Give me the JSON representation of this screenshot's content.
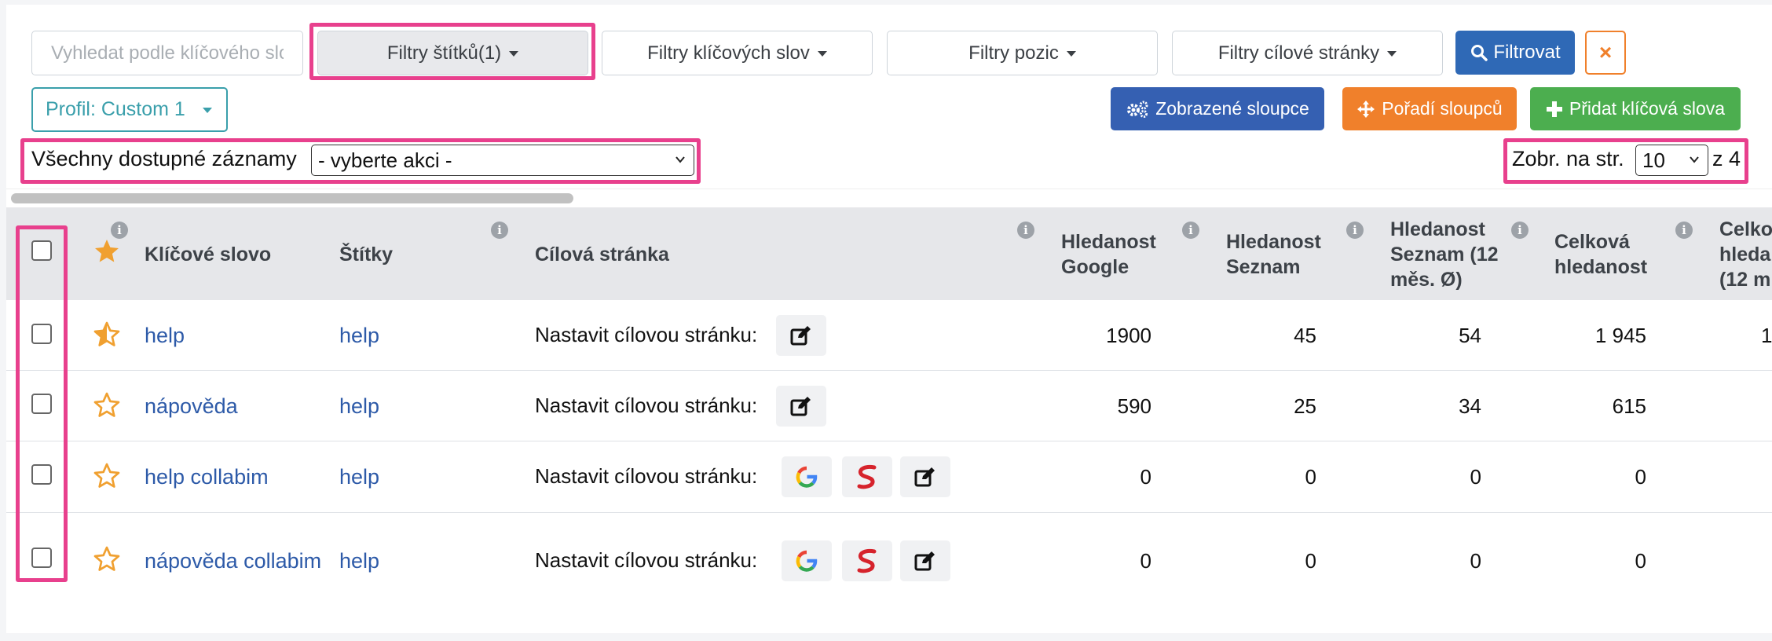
{
  "filters": {
    "search_placeholder": "Vyhledat podle klíčového slova",
    "tag_filter": "Filtry štítků(1)",
    "keyword_filter": "Filtry klíčových slov",
    "position_filter": "Filtry pozic",
    "target_filter": "Filtry cílové stránky",
    "apply": "Filtrovat",
    "clear": "×"
  },
  "profile": {
    "label": "Profil: Custom 1"
  },
  "actions": {
    "columns": "Zobrazené sloupce",
    "column_order": "Pořadí sloupců",
    "add_keywords": "Přidat klíčová slova"
  },
  "bulk": {
    "label": "Všechny dostupné záznamy",
    "select_value": "- vyberte akci -"
  },
  "pagination": {
    "label": "Zobr. na str.",
    "per_page": "10",
    "total": "z 4"
  },
  "columns": {
    "keyword": "Klíčové slovo",
    "tags": "Štítky",
    "target": "Cílová stránka",
    "google_l1": "Hledanost",
    "google_l2": "Google",
    "seznam_l1": "Hledanost",
    "seznam_l2": "Seznam",
    "seznam12_l1": "Hledanost",
    "seznam12_l2": "Seznam (12",
    "seznam12_l3": "měs. Ø)",
    "total_l1": "Celková",
    "total_l2": "hledanost",
    "cut_l1": "Celko",
    "cut_l2": "hleda",
    "cut_l3": "(12 m"
  },
  "rows": [
    {
      "keyword": "help",
      "tag": "help",
      "target_label": "Nastavit cílovou stránku:",
      "google": "1900",
      "seznam": "45",
      "seznam12": "54",
      "total": "1 945",
      "cut": "1"
    },
    {
      "keyword": "nápověda",
      "tag": "help",
      "target_label": "Nastavit cílovou stránku:",
      "google": "590",
      "seznam": "25",
      "seznam12": "34",
      "total": "615",
      "cut": ""
    },
    {
      "keyword": "help collabim",
      "tag": "help",
      "target_label": "Nastavit cílovou stránku:",
      "google": "0",
      "seznam": "0",
      "seznam12": "0",
      "total": "0",
      "cut": ""
    },
    {
      "keyword": "nápověda collabim",
      "tag": "help",
      "target_label": "Nastavit cílovou stránku:",
      "google": "0",
      "seznam": "0",
      "seznam12": "0",
      "total": "0",
      "cut": ""
    }
  ],
  "colors": {
    "primary": "#2f69b6",
    "orange": "#f0802b",
    "green": "#4cae4f",
    "teal": "#3a9fab",
    "highlight": "#e8408d",
    "star": "#f0a030"
  }
}
